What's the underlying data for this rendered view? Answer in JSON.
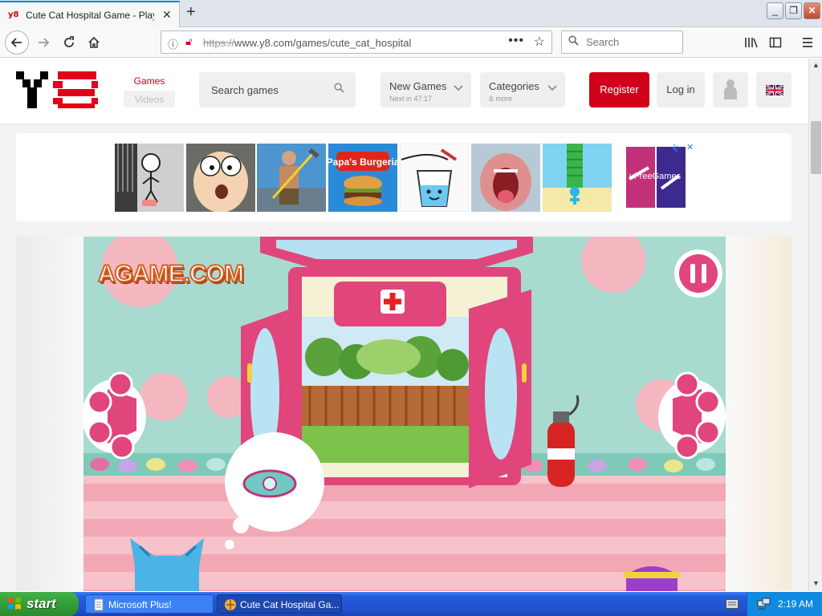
{
  "browser": {
    "tab_title": "Cute Cat Hospital Game - Play onli",
    "tab_favicon": "y8",
    "tab_close": "✕",
    "new_tab": "+",
    "url_scheme": "https://",
    "url_rest": "www.y8.com/games/cute_cat_hospital",
    "search_placeholder": "Search",
    "page_actions": "•••",
    "window_minimize": "_",
    "window_restore": "❐",
    "window_close": "✕"
  },
  "site": {
    "nav_games": "Games",
    "nav_videos": "Videos",
    "search_placeholder": "Search games",
    "new_games": {
      "label": "New Games",
      "sub": "Next in 47:17"
    },
    "categories": {
      "label": "Categories",
      "sub": "& more"
    },
    "register": "Register",
    "login": "Log in",
    "ad_brand": "uFreeGames",
    "colors": {
      "brand_red": "#d0021b"
    }
  },
  "thumbnails": [
    {
      "name": "thumb-stickman-escape",
      "label": ""
    },
    {
      "name": "thumb-morty-face",
      "label": ""
    },
    {
      "name": "thumb-getting-over-it",
      "label": ""
    },
    {
      "name": "thumb-papas-burgeria",
      "label": "Papa's Burgeria"
    },
    {
      "name": "thumb-happy-glass",
      "label": ""
    },
    {
      "name": "thumb-mouth-game",
      "label": ""
    },
    {
      "name": "thumb-stack-runner",
      "label": ""
    }
  ],
  "game": {
    "agame_logo": "AGAME.COM",
    "pause_icon": "pause-icon"
  },
  "taskbar": {
    "start": "start",
    "tasks": [
      "Microsoft Plus!",
      "Cute Cat Hospital Ga..."
    ],
    "clock": "2:19 AM"
  }
}
